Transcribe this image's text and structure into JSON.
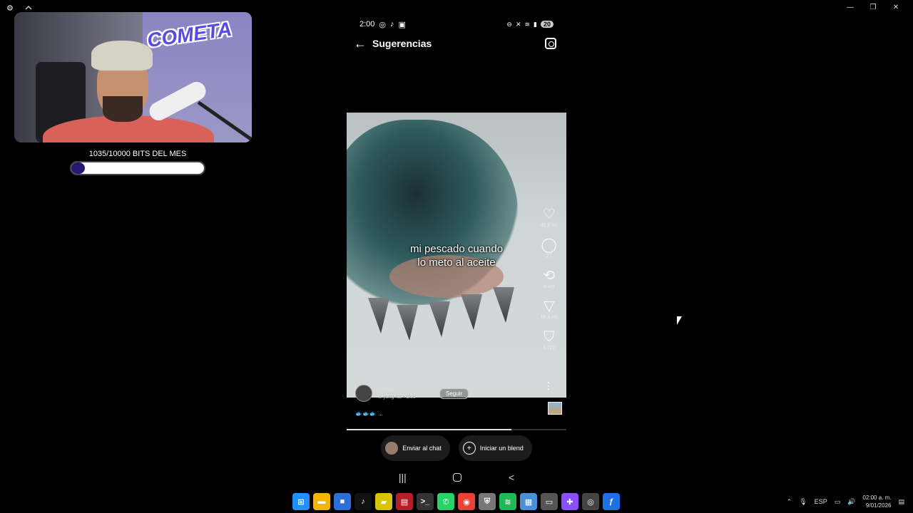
{
  "stream_overlay": {
    "logo_text": "COMETA",
    "bits_label": "1035/10000 BITS DEL MES",
    "bits_progress": 0.1035
  },
  "phone": {
    "status": {
      "time": "2:00",
      "battery": "20"
    },
    "appbar": {
      "back_label": "←",
      "title": "Sugerencias"
    },
    "video": {
      "caption_line1": "mi pescado cuando",
      "caption_line2": "lo meto al aceite",
      "likes": "88,8 mil",
      "comments": "27",
      "reposts": "4,4m",
      "shares": "16,4 mil",
      "saves": "3,720",
      "progress": 0.75
    },
    "author": {
      "username": "jocs.k",
      "song": "yung kai • blue",
      "follow_label": "Seguir",
      "description": "🐟🐟🐟 ..."
    },
    "bottom_actions": {
      "send_chat": "Enviar al chat",
      "start_blend": "Iniciar un blend"
    },
    "navbar": {
      "recents": "|||",
      "back": "<"
    }
  },
  "taskbar": {
    "apps": [
      {
        "name": "start",
        "glyph": "⊞",
        "color": "#1e90ff"
      },
      {
        "name": "file-explorer",
        "glyph": "▬",
        "color": "#f2b600"
      },
      {
        "name": "store",
        "glyph": "■",
        "color": "#2b6fd6"
      },
      {
        "name": "tiktok",
        "glyph": "♪",
        "color": "#111111"
      },
      {
        "name": "notes",
        "glyph": "▰",
        "color": "#d8c400"
      },
      {
        "name": "voice-meter",
        "glyph": "▤",
        "color": "#b3202a"
      },
      {
        "name": "terminal",
        "glyph": ">_",
        "color": "#333333"
      },
      {
        "name": "whatsapp",
        "glyph": "✆",
        "color": "#25d366"
      },
      {
        "name": "chrome",
        "glyph": "◉",
        "color": "#e94235"
      },
      {
        "name": "shield",
        "glyph": "⛨",
        "color": "#777777"
      },
      {
        "name": "spotify",
        "glyph": "≋",
        "color": "#1db954"
      },
      {
        "name": "app-grid",
        "glyph": "▦",
        "color": "#4a90d9"
      },
      {
        "name": "app-window",
        "glyph": "▭",
        "color": "#555555"
      },
      {
        "name": "game",
        "glyph": "✚",
        "color": "#8a4fff"
      },
      {
        "name": "obs",
        "glyph": "◎",
        "color": "#444444"
      },
      {
        "name": "scrcpy",
        "glyph": "ƒ",
        "color": "#1f6fe5"
      }
    ],
    "language": "ESP",
    "time": "02:00 a. m.",
    "date": "9/01/2026"
  }
}
